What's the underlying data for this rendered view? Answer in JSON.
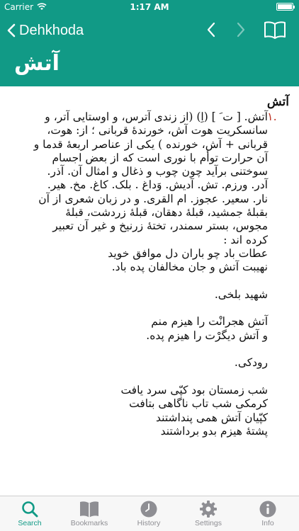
{
  "status_bar": {
    "carrier": "Carrier",
    "time": "1:17 AM"
  },
  "nav": {
    "back_label": "Dehkhoda",
    "icons": [
      "chevron-left-icon",
      "chevron-right-icon",
      "book-icon"
    ]
  },
  "entry": {
    "title": "آتش",
    "headword": "آتش",
    "sense_number": "۱.",
    "text": "آتش. [ ت َ ] (اِ) (از زندی آترس، و اوستایی آتر، و\nسانسکریت هوت آش، خورندهٔ قربانی ؛ از: هوت،\nقربانی + آش، خورنده ) یکی از عناصر اربعهٔ قدما و\nآن حرارت توأم با نوری است که از بعض اجسام\nسوختنی برآید چون چوب و ذغال و امثال آن. آذر.\nآدر. ورزم. تش. آدیش. وَداغ . بلک. کاغ. مخ. هیر.\nنار. سعیر. عجوز. ام القری. و در زبان شعری از آن\nبقبلهٔ جمشید، قبلهٔ دهقان، قبلهٔ زردشت، قبلهٔ\nمجوس، بستر سمندر، تختهٔ زرنیخ و غیر آن تعبیر\nکرده اند :\nعطات باد چو باران دل موافق خوید\nنهیبت آتش و جان مخالفان پده باد.\n\nشهید بلخی.\n\nآتش هجرانْت را هیزم منم\nو آتش دیگرْت را هیزم پده.\n\nرودکی.\n\nشب زمستان بود کپّی سرد یافت\nکرمکی شب تاب ناگاهی بتافت\nکپّیان آتش همی پنداشتند\nپشتهٔ هیزم بدو برداشتند"
  },
  "tabs": [
    {
      "label": "Search",
      "icon": "search-icon",
      "active": true
    },
    {
      "label": "Bookmarks",
      "icon": "bookmarks-icon",
      "active": false
    },
    {
      "label": "History",
      "icon": "history-icon",
      "active": false
    },
    {
      "label": "Settings",
      "icon": "settings-icon",
      "active": false
    },
    {
      "label": "Info",
      "icon": "info-icon",
      "active": false
    }
  ],
  "colors": {
    "accent": "#119a86",
    "sense_number": "#c0392b",
    "tab_inactive": "#8e8e93"
  }
}
